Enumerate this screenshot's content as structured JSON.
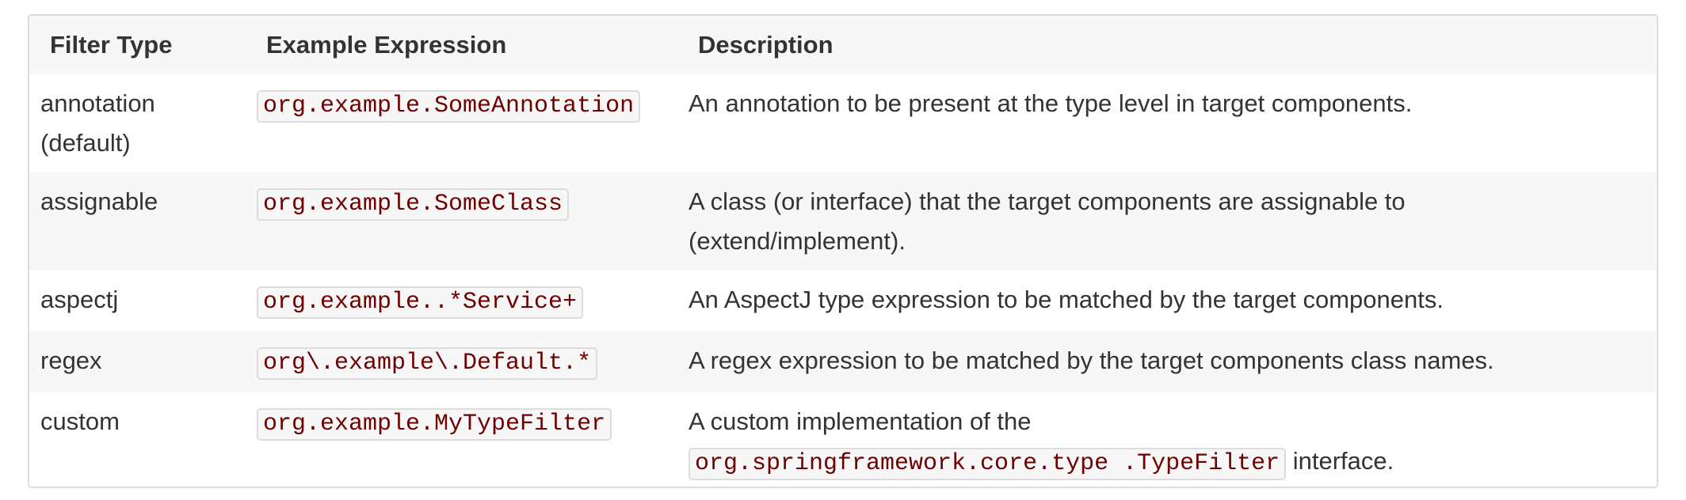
{
  "table": {
    "headers": [
      "Filter Type",
      "Example Expression",
      "Description"
    ],
    "rows": [
      {
        "type": "annotation (default)",
        "expression": "org.example.SomeAnnotation",
        "description": "An annotation to be present at the type level in target components."
      },
      {
        "type": "assignable",
        "expression": "org.example.SomeClass",
        "description": "A class (or interface) that the target components are assignable to (extend/implement)."
      },
      {
        "type": "aspectj",
        "expression": "org.example..*Service+",
        "description": "An AspectJ type expression to be matched by the target components."
      },
      {
        "type": "regex",
        "expression": "org\\.example\\.Default.*",
        "description": "A regex expression to be matched by the target components class names."
      },
      {
        "type": "custom",
        "expression": "org.example.MyTypeFilter",
        "description_prefix": "A custom implementation of the",
        "description_code": "org.springframework.core.type .TypeFilter",
        "description_suffix": "interface."
      }
    ]
  }
}
